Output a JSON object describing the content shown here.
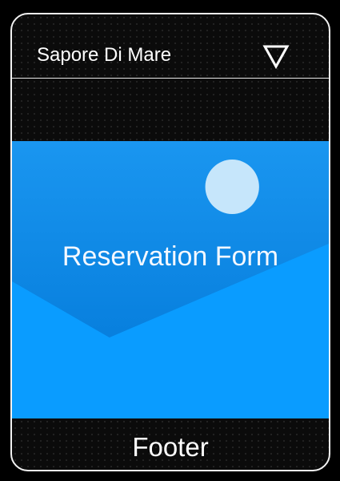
{
  "header": {
    "title": "Sapore Di Mare",
    "menu_icon": "triangle-down-icon"
  },
  "hero": {
    "title": "Reservation Form",
    "image_icon": "image-placeholder-icon",
    "colors": {
      "sky": "#0086e6",
      "sky_light": "#1a96f0",
      "hill": "#0a9cff",
      "sun": "#c6e6fb"
    }
  },
  "footer": {
    "label": "Footer"
  },
  "colors": {
    "background": "#000000",
    "card": "#0b0b0b",
    "border": "#f2f2f2",
    "text": "#ffffff"
  }
}
